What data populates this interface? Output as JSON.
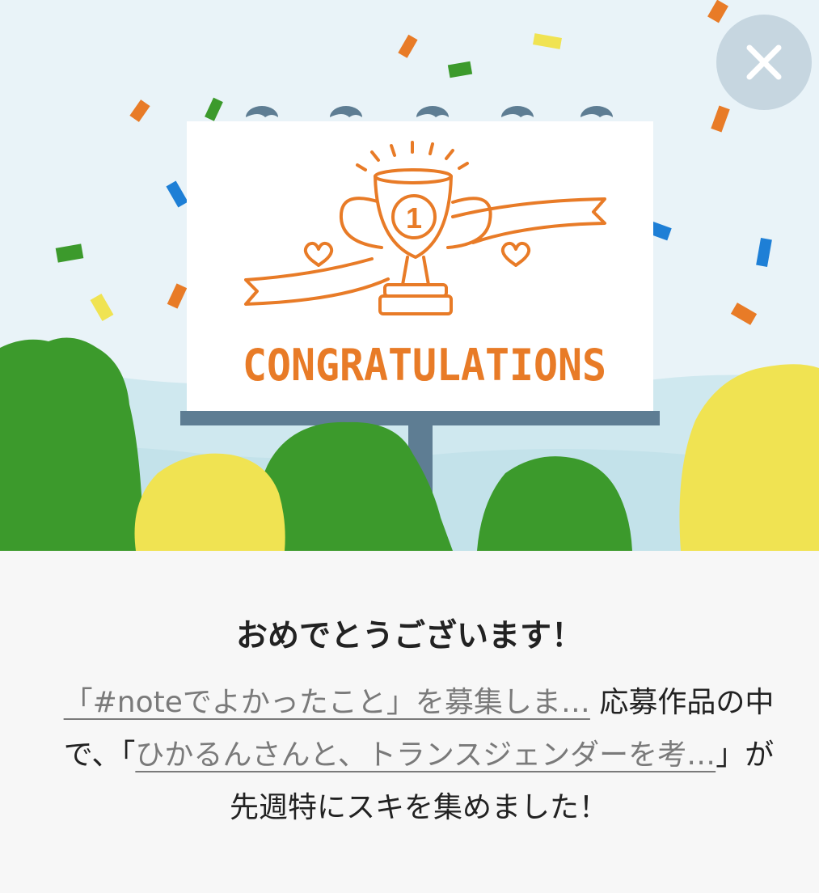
{
  "banner": {
    "sign_text": "CONGRATULATIONS",
    "trophy_number": "1",
    "colors": {
      "sky": "#e9f3f8",
      "board": "#ffffff",
      "post": "#5e7d93",
      "accent": "#e87b27",
      "green_tree": "#3c9a2c",
      "yellow_tree": "#f0e352"
    }
  },
  "close_button": {
    "icon": "close-icon"
  },
  "title": "おめでとうございます！",
  "message": {
    "link1": "「#noteでよかったこと」を募集しま…",
    "text1": " 応募作品の中で、「",
    "link2": "ひかるんさんと、トランスジェンダーを考…",
    "text2": "」が先週特にスキを集めました！"
  }
}
